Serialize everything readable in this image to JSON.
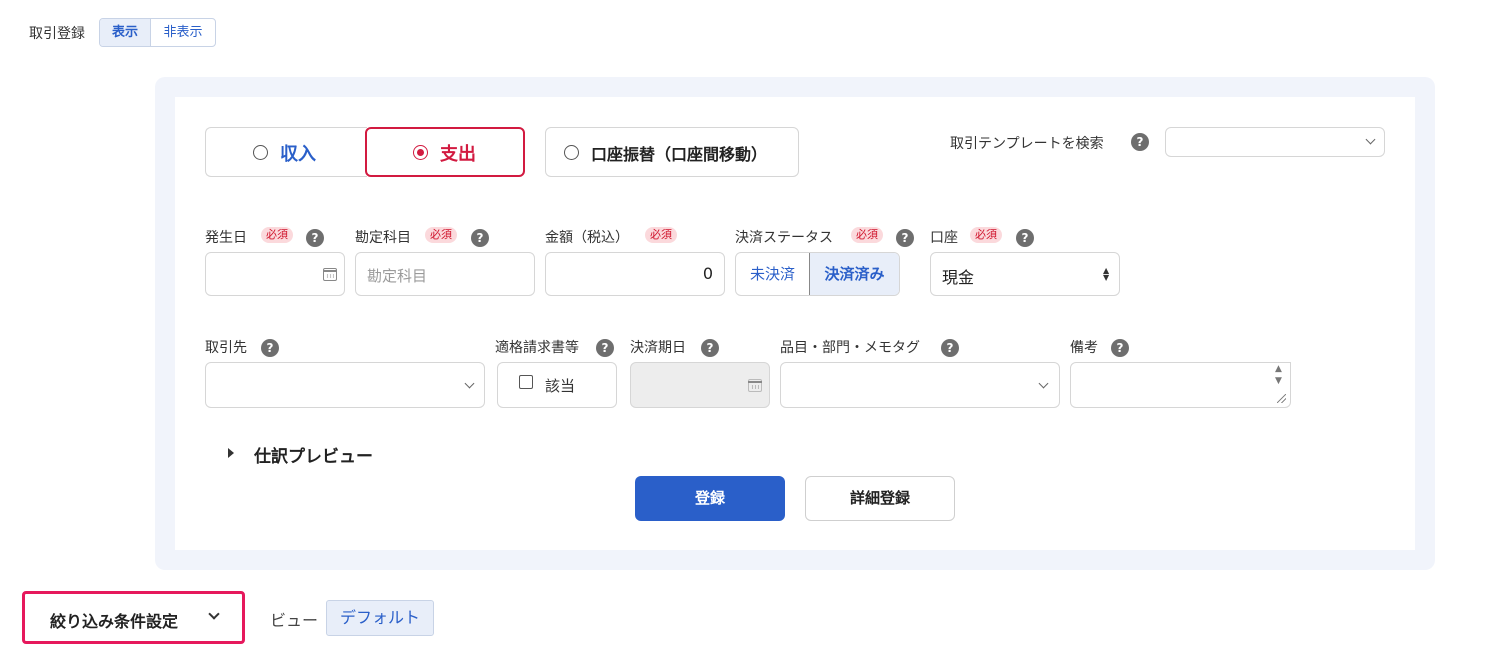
{
  "header": {
    "label": "取引登録",
    "toggle_show": "表示",
    "toggle_hide": "非表示"
  },
  "tx_types": {
    "income": "収入",
    "expense": "支出",
    "transfer": "口座振替（口座間移動）"
  },
  "template": {
    "label": "取引テンプレートを検索",
    "help": "?"
  },
  "fields": {
    "date": {
      "label": "発生日"
    },
    "account_item": {
      "label": "勘定科目",
      "placeholder": "勘定科目"
    },
    "amount": {
      "label": "金額（税込）",
      "value": "0"
    },
    "status": {
      "label": "決済ステータス",
      "unpaid": "未決済",
      "paid": "決済済み"
    },
    "account": {
      "label": "口座",
      "value": "現金"
    },
    "partner": {
      "label": "取引先"
    },
    "invoice": {
      "label": "適格請求書等",
      "checkbox_label": "該当"
    },
    "due_date": {
      "label": "決済期日"
    },
    "tags": {
      "label": "品目・部門・メモタグ"
    },
    "memo": {
      "label": "備考"
    }
  },
  "required_badge": "必須",
  "help_icon": "?",
  "preview": {
    "label": "仕訳プレビュー"
  },
  "buttons": {
    "register": "登録",
    "detail_register": "詳細登録"
  },
  "filter": {
    "label": "絞り込み条件設定",
    "view_label": "ビュー",
    "view_value": "デフォルト"
  },
  "colors": {
    "primary": "#2a5fc9",
    "danger": "#d21a40",
    "panel": "#f1f4fb"
  }
}
